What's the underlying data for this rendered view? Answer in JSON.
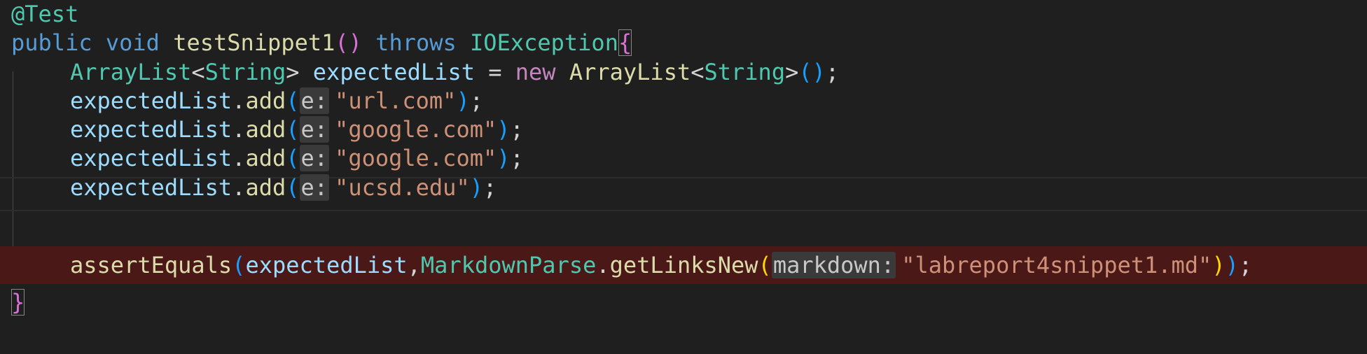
{
  "code": {
    "annotation": "@Test",
    "line2": {
      "public": "public",
      "void": "void",
      "method": "testSnippet1",
      "parens": "()",
      "throws": "throws",
      "exception": "IOException",
      "brace": "{"
    },
    "line3": {
      "type1": "ArrayList",
      "lt1": "<",
      "generic1": "String",
      "gt1": ">",
      "varname": "expectedList",
      "eq": "=",
      "new": "new",
      "type2": "ArrayList",
      "lt2": "<",
      "generic2": "String",
      "gt2": ">",
      "parens": "()",
      "semi": ";"
    },
    "add_calls": [
      {
        "obj": "expectedList",
        "dot": ".",
        "method": "add",
        "open": "(",
        "hint": "e:",
        "arg": "\"url.com\"",
        "close": ")",
        "semi": ";"
      },
      {
        "obj": "expectedList",
        "dot": ".",
        "method": "add",
        "open": "(",
        "hint": "e:",
        "arg": "\"google.com\"",
        "close": ")",
        "semi": ";"
      },
      {
        "obj": "expectedList",
        "dot": ".",
        "method": "add",
        "open": "(",
        "hint": "e:",
        "arg": "\"google.com\"",
        "close": ")",
        "semi": ";"
      },
      {
        "obj": "expectedList",
        "dot": ".",
        "method": "add",
        "open": "(",
        "hint": "e:",
        "arg": "\"ucsd.edu\"",
        "close": ")",
        "semi": ";"
      }
    ],
    "assert_line": {
      "method": "assertEquals",
      "open1": "(",
      "arg1": "expectedList",
      "comma": ",",
      "class": "MarkdownParse",
      "dot": ".",
      "method2": "getLinksNew",
      "open2": "(",
      "hint": "markdown:",
      "arg2": "\"labreport4snippet1.md\"",
      "close2": ")",
      "close1": ")",
      "semi": ";"
    },
    "closing_brace": "}"
  },
  "colors": {
    "background": "#1f1f1f",
    "error_line": "#4b1818"
  }
}
